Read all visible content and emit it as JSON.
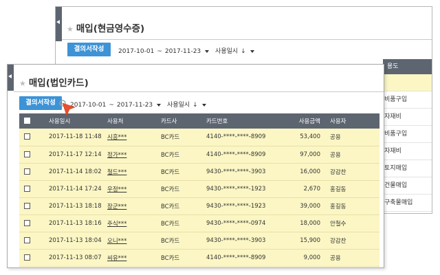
{
  "back_window": {
    "title": "매입(현금영수증)",
    "create_button": "결의서작성",
    "date_from": "2017-10-01",
    "date_sep": "~",
    "date_to": "2017-11-23",
    "sort_label": "사용일시",
    "sort_arrow": "↓",
    "partial_header": "용도",
    "partial_cells": [
      "",
      "비품구입",
      "자재비",
      "비품구입",
      "자재비",
      "토지매입",
      "건물매입",
      "구축물매입"
    ]
  },
  "front_window": {
    "title": "매입(법인카드)",
    "create_button": "결의서작성",
    "date_from": "2017-10-01",
    "date_sep": "~",
    "date_to": "2017-11-23",
    "sort_label": "사용일시",
    "sort_arrow": "↓",
    "columns": [
      "사용일시",
      "사용처",
      "카드사",
      "카드번호",
      "사용금액",
      "사용자"
    ],
    "rows": [
      {
        "datetime": "2017-11-18 11:48",
        "merchant": "시흥***",
        "card_company": "BC카드",
        "card_number": "4140-****-****-8909",
        "amount": "53,400",
        "user": "공용"
      },
      {
        "datetime": "2017-11-17 12:14",
        "merchant": "정가***",
        "card_company": "BC카드",
        "card_number": "4140-****-****-8909",
        "amount": "97,000",
        "user": "공용"
      },
      {
        "datetime": "2017-11-14 18:02",
        "merchant": "철드***",
        "card_company": "BC카드",
        "card_number": "9430-****-****-3903",
        "amount": "16,000",
        "user": "강감찬"
      },
      {
        "datetime": "2017-11-14 17:24",
        "merchant": "우정***",
        "card_company": "BC카드",
        "card_number": "9430-****-****-1923",
        "amount": "2,670",
        "user": "홍길동"
      },
      {
        "datetime": "2017-11-13 18:18",
        "merchant": "장군***",
        "card_company": "BC카드",
        "card_number": "9430-****-****-1923",
        "amount": "39,000",
        "user": "홍길동"
      },
      {
        "datetime": "2017-11-13 18:16",
        "merchant": "주식***",
        "card_company": "BC카드",
        "card_number": "9430-****-****-0974",
        "amount": "18,000",
        "user": "안철수"
      },
      {
        "datetime": "2017-11-13 18:04",
        "merchant": "오니***",
        "card_company": "BC카드",
        "card_number": "9430-****-****-3903",
        "amount": "15,900",
        "user": "강감찬"
      },
      {
        "datetime": "2017-11-13 08:07",
        "merchant": "씨유***",
        "card_company": "BC카드",
        "card_number": "4140-****-****-8909",
        "amount": "9,000",
        "user": "공용"
      }
    ]
  },
  "colors": {
    "header_bg": "#5d6570",
    "button_blue": "#3d93d6",
    "row_yellow": "#fbf6c4",
    "cursor_red": "#e8502e"
  }
}
